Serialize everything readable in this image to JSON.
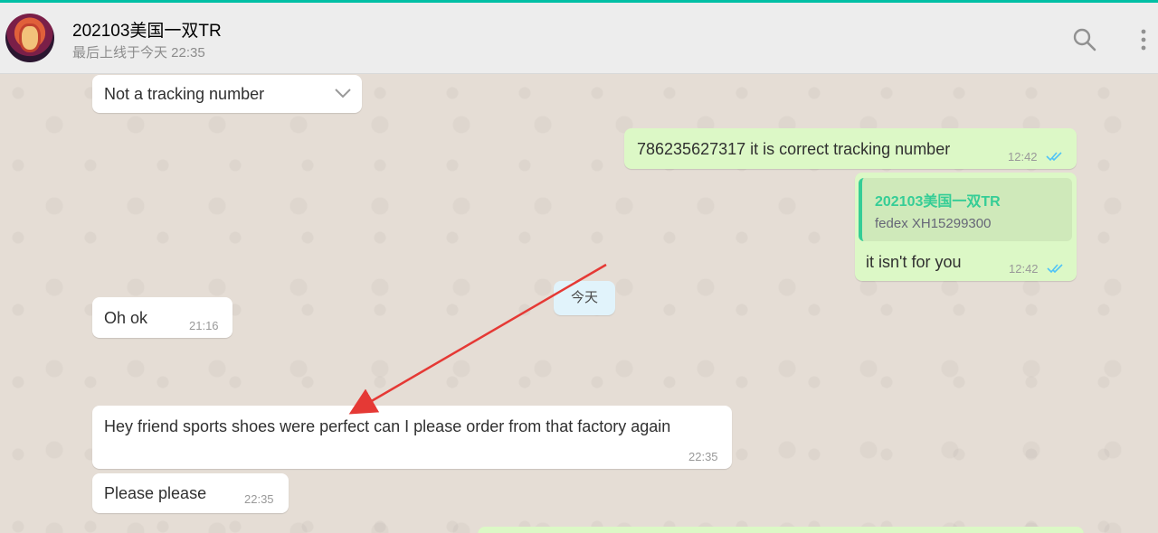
{
  "header": {
    "chat_name": "202103美国一双TR",
    "status": "最后上线于今天 22:35"
  },
  "messages": {
    "m0": {
      "text": "Not a tracking number"
    },
    "m1": {
      "text": "786235627317 it is correct tracking number",
      "time": "12:42"
    },
    "m2": {
      "quote_author": "202103美国一双TR",
      "quote_text": "fedex  XH15299300",
      "text": "it isn't for you",
      "time": "12:42"
    },
    "m3": {
      "text": "Oh ok",
      "time": "21:16"
    },
    "date_divider": "今天",
    "m4": {
      "text": "Hey friend sports shoes were perfect can I please order from that factory again",
      "time": "22:35"
    },
    "m5": {
      "text": "Please please",
      "time": "22:35"
    }
  },
  "colors": {
    "accent": "#00bfa5",
    "outgoing_bubble": "#dcf8c6",
    "incoming_bubble": "#ffffff",
    "read_tick": "#4fc3f7",
    "annotation_arrow": "#e53935"
  },
  "icons": [
    "search-icon",
    "menu-dots-icon",
    "chevron-down-icon",
    "double-check-icon"
  ]
}
